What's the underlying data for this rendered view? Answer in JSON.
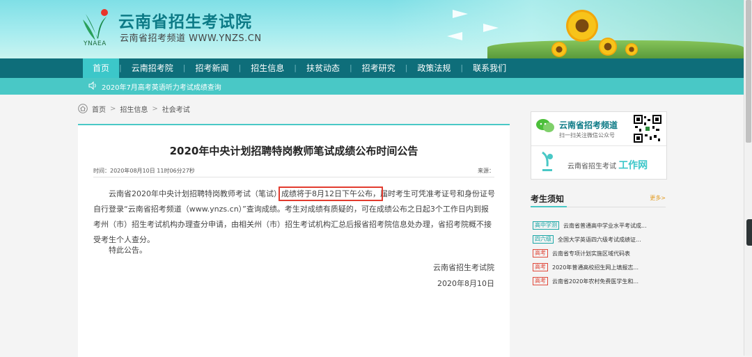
{
  "header": {
    "title": "云南省招生考试院",
    "subtitle": "云南省招考频道 WWW.YNZS.CN",
    "logo_text": "YNAEA"
  },
  "nav": {
    "items": [
      {
        "label": "首页",
        "active": true
      },
      {
        "label": "云南招考院"
      },
      {
        "label": "招考新闻"
      },
      {
        "label": "招生信息"
      },
      {
        "label": "扶贫动态"
      },
      {
        "label": "招考研究"
      },
      {
        "label": "政策法规"
      },
      {
        "label": "联系我们"
      }
    ],
    "separator": "|"
  },
  "ticker": {
    "text": "2020年7月高考英语听力考试成绩查询",
    "icon": "speaker-icon"
  },
  "breadcrumb": {
    "home": "首页",
    "level1": "招生信息",
    "level2": "社会考试",
    "separator": ">"
  },
  "article": {
    "title": "2020年中央计划招聘特岗教师笔试成绩公布时间公告",
    "time": "时间：2020年08月10日 11时06分27秒",
    "source": "来源：",
    "p1_a": "云南省2020年中央计划招聘特岗教师考试（笔试）",
    "p1_hl": "成绩将于8月12日下午公布，",
    "p1_b": "届时考生可凭准考证号和身份证号自行登录“云南省招考频道（www.ynzs.cn）”查询成绩。考生对成绩有质疑的，可在成绩公布之日起3个工作日内到报考州（市）招生考试机构办理查分申请，由相关州（市）招生考试机构汇总后报省招考院信息处办理，省招考院概不接受考生个人查分。",
    "p2": "特此公告。",
    "sign_org": "云南省招生考试院",
    "sign_date": "2020年8月10日"
  },
  "sidebar": {
    "qr_title": "云南省招考频道",
    "qr_sub": "扫一扫关注微信公众号",
    "work_prefix": "云南省招生考试",
    "work_accent": "工作网",
    "notice_title": "考生须知",
    "notice_more": "更多>",
    "notices": [
      {
        "tag": "高中学测",
        "tag_color": "teal",
        "text": "云南省普通高中学业水平考试成..."
      },
      {
        "tag": "四六级",
        "tag_color": "teal",
        "text": "全国大学英语四六级考试成绩证..."
      },
      {
        "tag": "高考",
        "tag_color": "red",
        "text": "云南省专项计划实施区域代码表"
      },
      {
        "tag": "高考",
        "tag_color": "red",
        "text": "2020年普通高校招生网上填报志..."
      },
      {
        "tag": "高考",
        "tag_color": "red",
        "text": "云南省2020年农村免费医学生和..."
      }
    ]
  },
  "colors": {
    "teal": "#49c8c6",
    "nav": "#0e6e7a",
    "highlight": "#e23b2e",
    "tag_red": "#e0483a",
    "tag_teal": "#19a6a6"
  }
}
